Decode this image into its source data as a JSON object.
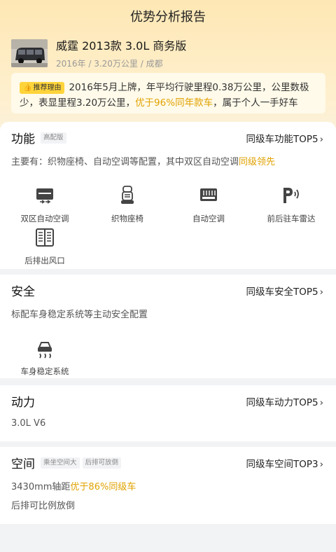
{
  "header": {
    "title": "优势分析报告"
  },
  "car": {
    "name": "威霆 2013款 3.0L 商务版",
    "meta": "2016年 / 3.20万公里 / 成都"
  },
  "reason": {
    "tag": "推荐理由",
    "text_before": "2016年5月上牌，年平均行驶里程0.38万公里，公里数极少，表显里程3.20万公里，",
    "highlight": "优于96%同年款车",
    "text_after": "，属于个人一手好车"
  },
  "sections": {
    "function": {
      "title": "功能",
      "tags": [
        "高配版"
      ],
      "link": "同级车功能TOP5",
      "desc_before": "主要有：织物座椅、自动空调等配置，其中双区自动空调",
      "desc_highlight": "同级领先",
      "features": [
        "双区自动空调",
        "织物座椅",
        "自动空调",
        "前后驻车雷达",
        "后排出风口"
      ]
    },
    "safety": {
      "title": "安全",
      "link": "同级车安全TOP5",
      "desc": "标配车身稳定系统等主动安全配置",
      "features": [
        "车身稳定系统"
      ]
    },
    "power": {
      "title": "动力",
      "link": "同级车动力TOP5",
      "desc": "3.0L V6"
    },
    "space": {
      "title": "空间",
      "tags": [
        "乘坐空间大",
        "后排可放倒"
      ],
      "link": "同级车空间TOP3",
      "desc1_before": "3430mm轴距",
      "desc1_highlight": "优于86%同级车",
      "desc2": "后排可比例放倒"
    }
  },
  "chevron": "›",
  "colors": {
    "accent": "#e0a200",
    "tag_yellow": "#ffd43b",
    "header_bg": "#fde7b4"
  }
}
